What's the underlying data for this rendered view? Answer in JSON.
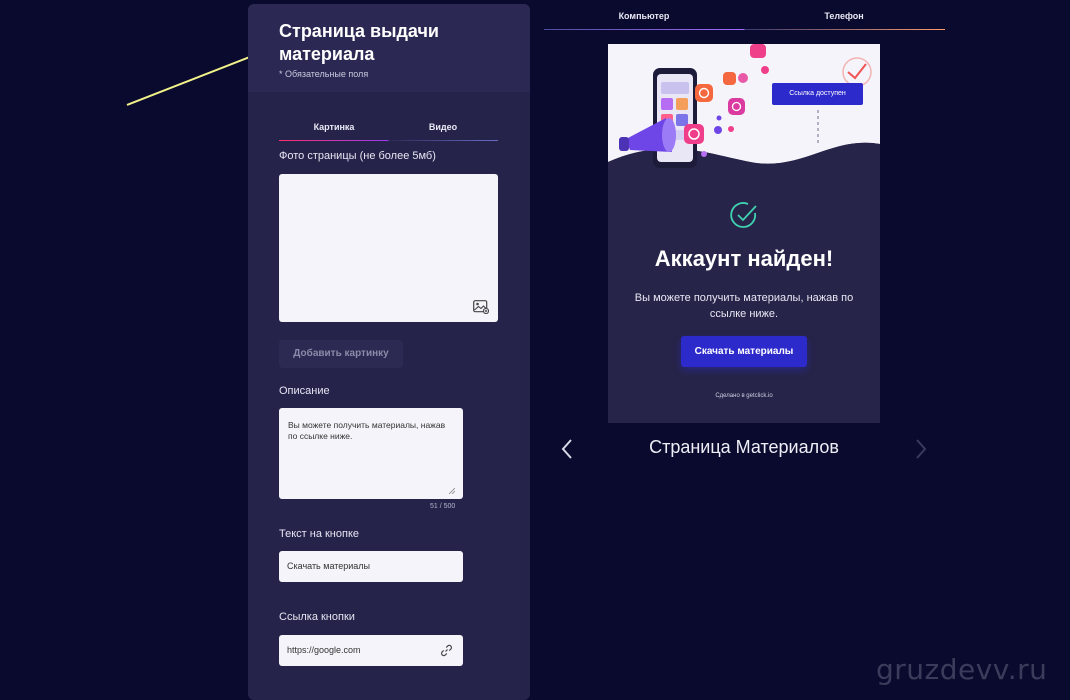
{
  "editor": {
    "title": "Страница выдачи материала",
    "subtitle": "* Обязательные поля",
    "tabs": [
      {
        "label": "Картинка",
        "active": true
      },
      {
        "label": "Видео",
        "active": false
      }
    ],
    "photo_label": "Фото страницы (не более 5мб)",
    "add_image_button": "Добавить картинку",
    "description_label": "Описание",
    "description_value": "Вы можете получить материалы, нажав по ссылке ниже.",
    "description_counter": "51 / 500",
    "button_text_label": "Текст на кнопке",
    "button_text_value": "Скачать материалы",
    "button_link_label": "Ссылка кнопки",
    "button_link_value": "https://google.com"
  },
  "preview": {
    "device_tabs": [
      {
        "label": "Компьютер",
        "active": true
      },
      {
        "label": "Телефон",
        "active": false
      }
    ],
    "hero_link_button": "Ссылка доступен",
    "heading": "Аккаунт найден!",
    "text": "Вы можете получить материалы, нажав по ссылке ниже.",
    "button": "Скачать материалы",
    "footer": "Сделано в getclick.io",
    "page_name": "Страница Материалов"
  },
  "watermark": "gruzdevv.ru",
  "colors": {
    "background": "#0a0a2e",
    "panel": "#25234a",
    "accent_button": "#2d2acb",
    "arrow": "#f2f28a"
  }
}
